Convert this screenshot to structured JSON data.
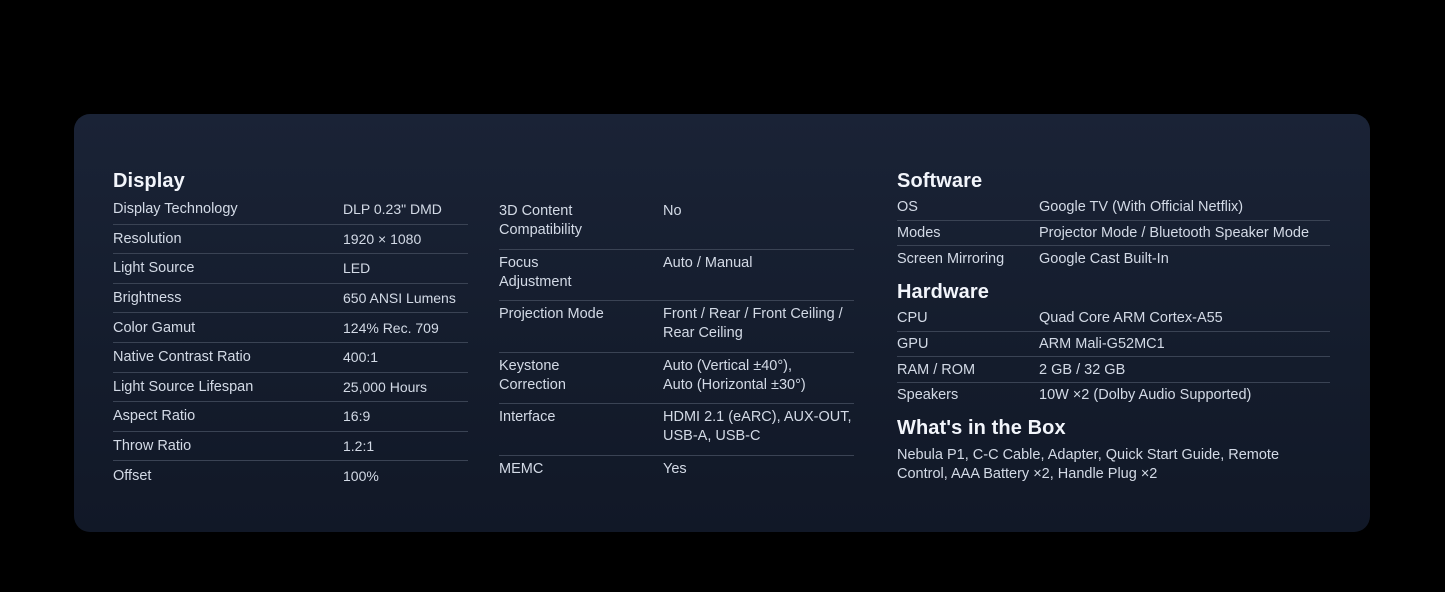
{
  "display": {
    "title": "Display",
    "rows": [
      {
        "label": "Display Technology",
        "value": "DLP 0.23\" DMD"
      },
      {
        "label": "Resolution",
        "value": "1920 × 1080"
      },
      {
        "label": "Light Source",
        "value": "LED"
      },
      {
        "label": "Brightness",
        "value": "650 ANSI Lumens"
      },
      {
        "label": "Color Gamut",
        "value": "124% Rec. 709"
      },
      {
        "label": "Native Contrast Ratio",
        "value": "400:1"
      },
      {
        "label": "Light Source Lifespan",
        "value": "25,000 Hours"
      },
      {
        "label": "Aspect Ratio",
        "value": "16:9"
      },
      {
        "label": "Throw Ratio",
        "value": "1.2:1"
      },
      {
        "label": "Offset",
        "value": "100%"
      }
    ]
  },
  "projection": {
    "rows": [
      {
        "label_line1": "3D Content",
        "label_line2": "Compatibility",
        "value_line1": "No",
        "value_line2": ""
      },
      {
        "label_line1": "Focus",
        "label_line2": "Adjustment",
        "value_line1": "Auto / Manual",
        "value_line2": ""
      },
      {
        "label_line1": "Projection Mode",
        "label_line2": "",
        "value_line1": "Front / Rear / Front Ceiling /",
        "value_line2": "Rear Ceiling"
      },
      {
        "label_line1": "Keystone",
        "label_line2": "Correction",
        "value_line1": "Auto (Vertical ±40°),",
        "value_line2": "Auto (Horizontal ±30°)"
      },
      {
        "label_line1": "Interface",
        "label_line2": "",
        "value_line1": "HDMI 2.1 (eARC), AUX-OUT,",
        "value_line2": "USB-A, USB-C"
      },
      {
        "label_line1": "MEMC",
        "label_line2": "",
        "value_line1": "Yes",
        "value_line2": ""
      }
    ]
  },
  "software": {
    "title": "Software",
    "rows": [
      {
        "label": "OS",
        "value": "Google TV (With Official Netflix)"
      },
      {
        "label": "Modes",
        "value": "Projector Mode / Bluetooth Speaker Mode"
      },
      {
        "label": "Screen Mirroring",
        "value": "Google Cast Built-In"
      }
    ]
  },
  "hardware": {
    "title": "Hardware",
    "rows": [
      {
        "label": "CPU",
        "value": "Quad Core ARM Cortex-A55"
      },
      {
        "label": "GPU",
        "value": "ARM Mali-G52MC1"
      },
      {
        "label": "RAM / ROM",
        "value": "2 GB / 32 GB"
      },
      {
        "label": "Speakers",
        "value": "10W ×2 (Dolby Audio Supported)"
      }
    ]
  },
  "box": {
    "title": "What's in the Box",
    "line1": "Nebula P1, C-C Cable, Adapter, Quick Start Guide, Remote",
    "line2": "Control, AAA Battery ×2, Handle Plug ×2"
  }
}
